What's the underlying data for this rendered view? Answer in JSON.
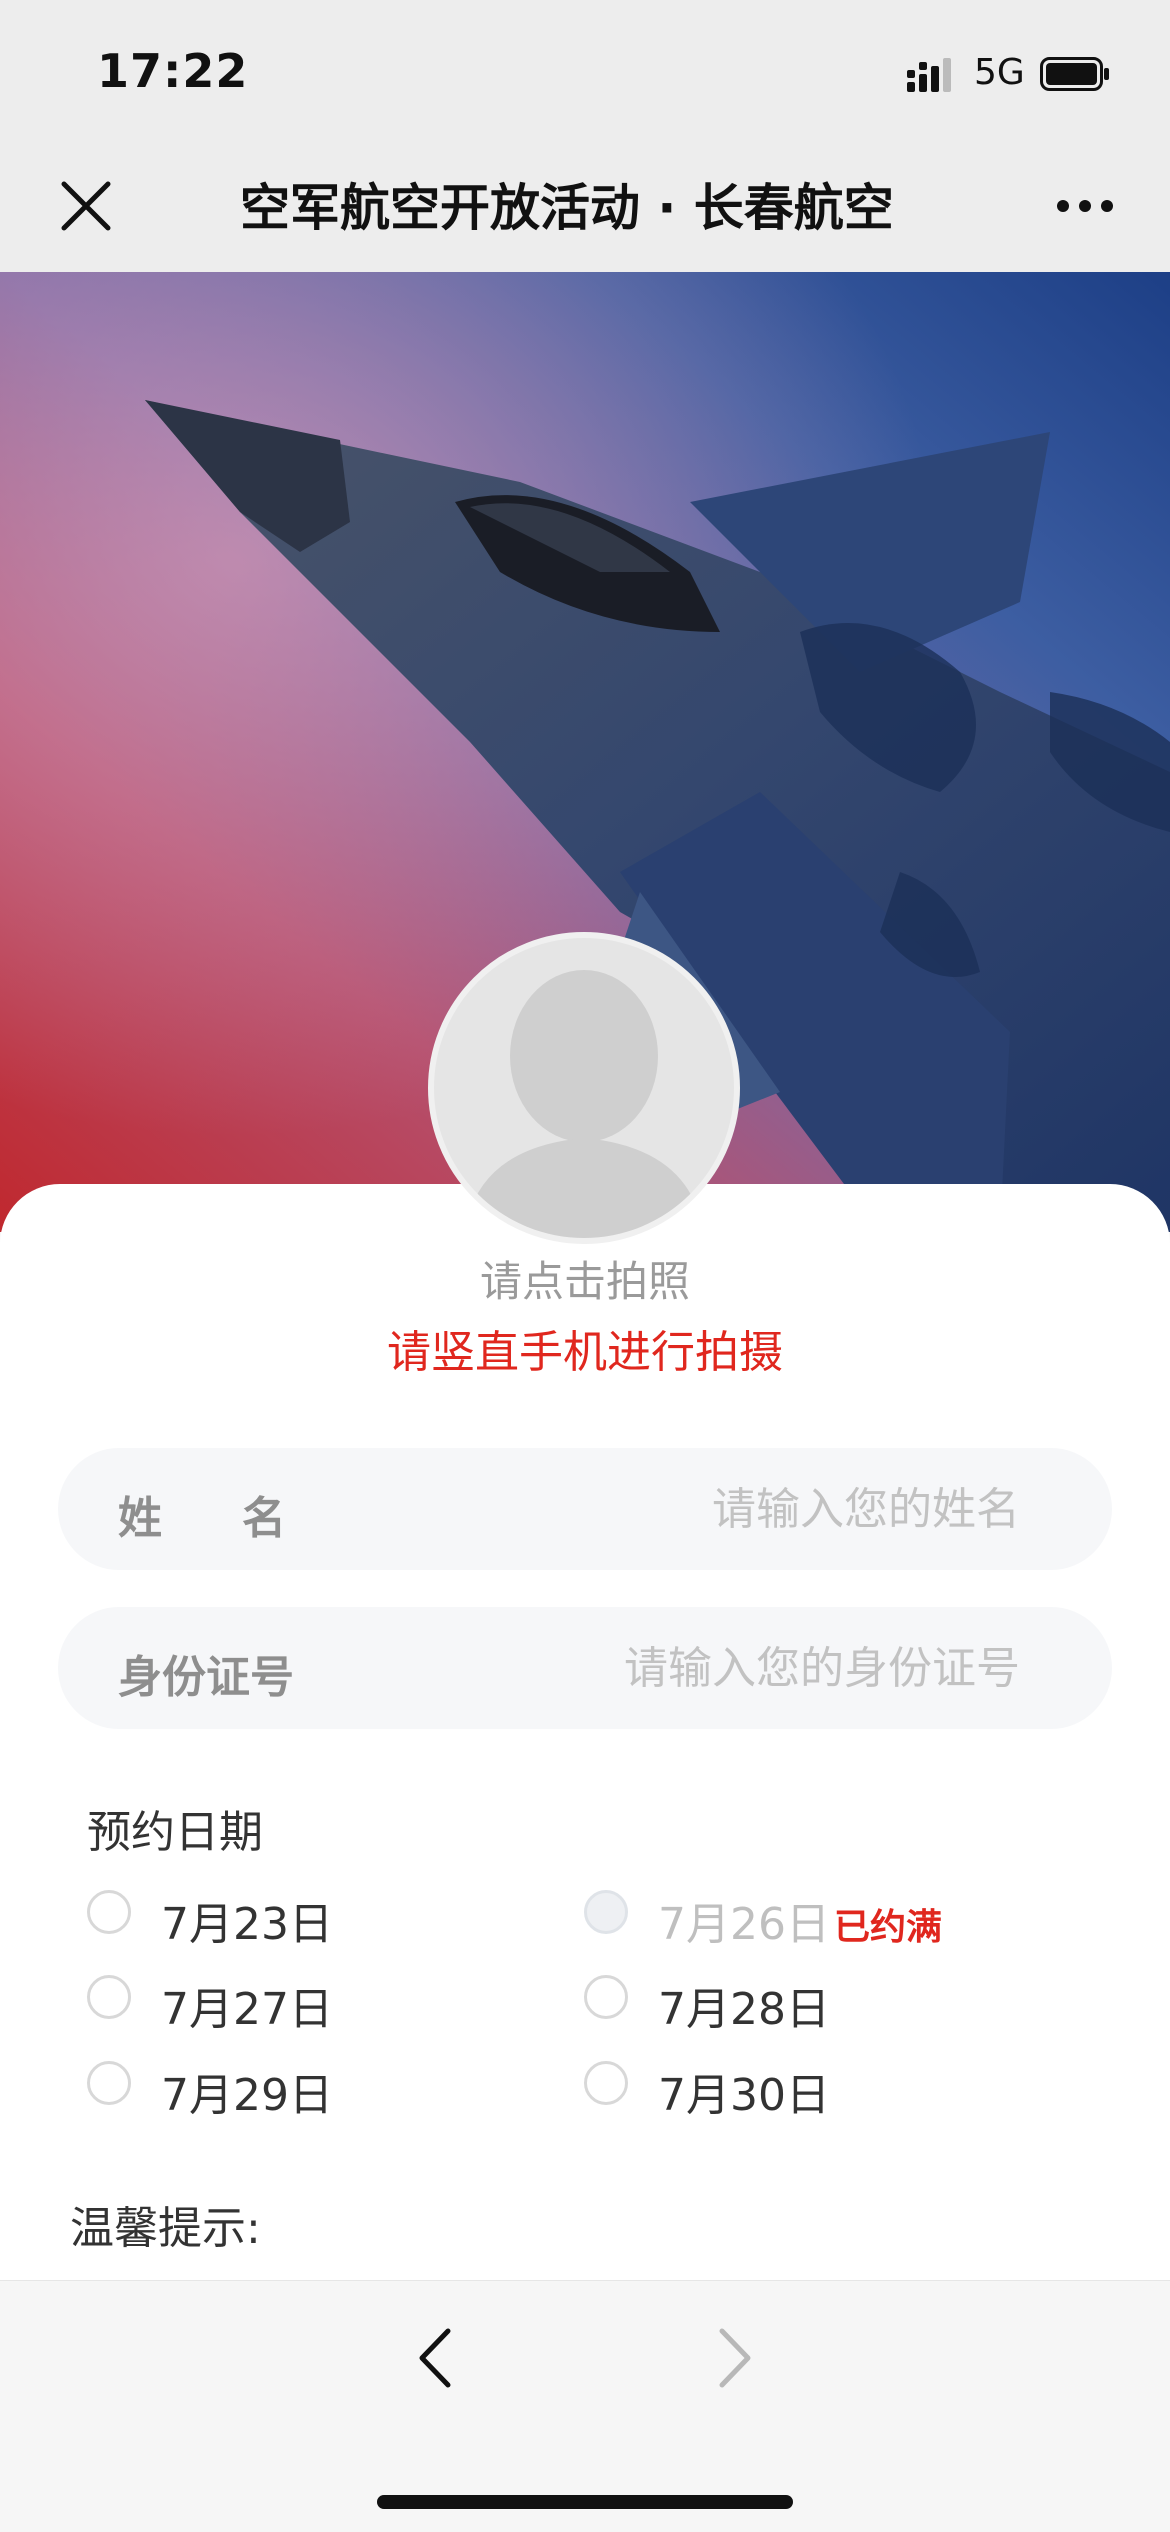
{
  "status_bar": {
    "time": "17:22",
    "network": "5G"
  },
  "nav": {
    "title": "空军航空开放活动 · 长春航空"
  },
  "photo": {
    "hint": "请点击拍照",
    "warning": "请竖直手机进行拍摄"
  },
  "form": {
    "name_label": "姓名",
    "name_placeholder": "请输入您的姓名",
    "id_label": "身份证号",
    "id_placeholder": "请输入您的身份证号",
    "date_title": "预约日期",
    "dates": [
      {
        "label": "7月23日"
      },
      {
        "label": "7月26日",
        "status": "已约满"
      },
      {
        "label": "7月27日"
      },
      {
        "label": "7月28日"
      },
      {
        "label": "7月29日"
      },
      {
        "label": "7月30日"
      }
    ],
    "tips_title": "温馨提示:"
  },
  "colors": {
    "accent_red": "#e0271e",
    "placeholder": "#c2c2c2"
  }
}
